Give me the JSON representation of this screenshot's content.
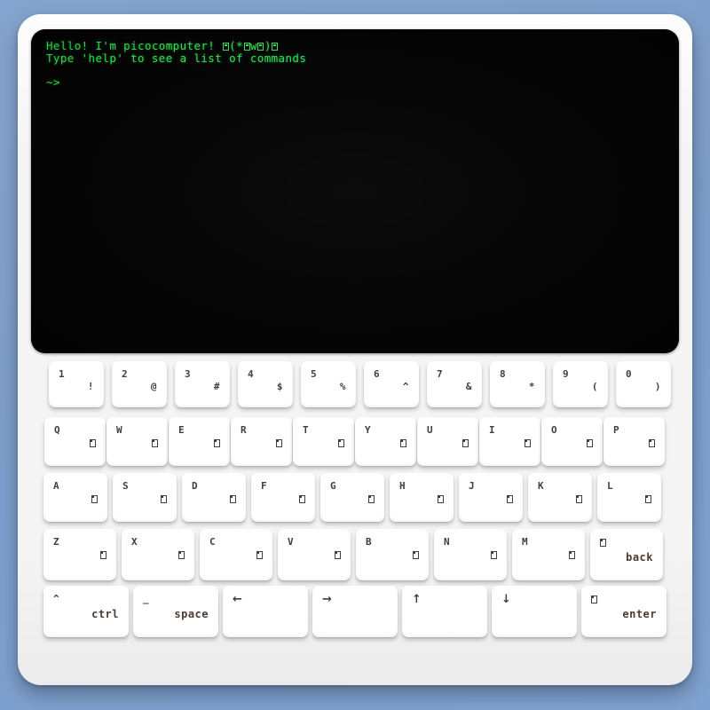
{
  "app": {
    "name": "picocomputer",
    "background_color": "#7fa1cd",
    "body_color": "#f4f4f4",
    "screen_color": "#000000",
    "screen_text_color": "#2de04f",
    "key_color": "#ffffff",
    "key_label_color": "#4a3c33"
  },
  "screen": {
    "lines": [
      "Hello! I'm picocomputer! □(*□w□)□",
      "Type 'help' to see a list of commands",
      "",
      "~>"
    ],
    "line1_prefix": "Hello! I'm picocomputer! ",
    "line2": "Type 'help' to see a list of commands",
    "prompt": "~>",
    "cursor": ""
  },
  "keyboard": {
    "rows": [
      {
        "name": "number-row",
        "keys": [
          {
            "name": "key-1",
            "main": "1",
            "secondary": "!",
            "sec_type": "text"
          },
          {
            "name": "key-2",
            "main": "2",
            "secondary": "@",
            "sec_type": "text"
          },
          {
            "name": "key-3",
            "main": "3",
            "secondary": "#",
            "sec_type": "text"
          },
          {
            "name": "key-4",
            "main": "4",
            "secondary": "$",
            "sec_type": "text"
          },
          {
            "name": "key-5",
            "main": "5",
            "secondary": "%",
            "sec_type": "text"
          },
          {
            "name": "key-6",
            "main": "6",
            "secondary": "^",
            "sec_type": "text"
          },
          {
            "name": "key-7",
            "main": "7",
            "secondary": "&",
            "sec_type": "text"
          },
          {
            "name": "key-8",
            "main": "8",
            "secondary": "*",
            "sec_type": "text"
          },
          {
            "name": "key-9",
            "main": "9",
            "secondary": "(",
            "sec_type": "text"
          },
          {
            "name": "key-0",
            "main": "0",
            "secondary": ")",
            "sec_type": "text"
          }
        ]
      },
      {
        "name": "qwerty-row",
        "keys": [
          {
            "name": "key-q",
            "main": "Q",
            "secondary": "□",
            "sec_type": "tofu"
          },
          {
            "name": "key-w",
            "main": "W",
            "secondary": "□",
            "sec_type": "tofu"
          },
          {
            "name": "key-e",
            "main": "E",
            "secondary": "□",
            "sec_type": "tofu"
          },
          {
            "name": "key-r",
            "main": "R",
            "secondary": "□",
            "sec_type": "tofu"
          },
          {
            "name": "key-t",
            "main": "T",
            "secondary": "□",
            "sec_type": "tofu"
          },
          {
            "name": "key-y",
            "main": "Y",
            "secondary": "□",
            "sec_type": "tofu"
          },
          {
            "name": "key-u",
            "main": "U",
            "secondary": "□",
            "sec_type": "tofu"
          },
          {
            "name": "key-i",
            "main": "I",
            "secondary": "□",
            "sec_type": "tofu"
          },
          {
            "name": "key-o",
            "main": "O",
            "secondary": "□",
            "sec_type": "tofu"
          },
          {
            "name": "key-p",
            "main": "P",
            "secondary": "□",
            "sec_type": "tofu"
          }
        ]
      },
      {
        "name": "home-row",
        "keys": [
          {
            "name": "key-a",
            "main": "A",
            "secondary": "□",
            "sec_type": "tofu"
          },
          {
            "name": "key-s",
            "main": "S",
            "secondary": "□",
            "sec_type": "tofu"
          },
          {
            "name": "key-d",
            "main": "D",
            "secondary": "□",
            "sec_type": "tofu"
          },
          {
            "name": "key-f",
            "main": "F",
            "secondary": "□",
            "sec_type": "tofu"
          },
          {
            "name": "key-g",
            "main": "G",
            "secondary": "□",
            "sec_type": "tofu"
          },
          {
            "name": "key-h",
            "main": "H",
            "secondary": "□",
            "sec_type": "tofu"
          },
          {
            "name": "key-j",
            "main": "J",
            "secondary": "□",
            "sec_type": "tofu"
          },
          {
            "name": "key-k",
            "main": "K",
            "secondary": "□",
            "sec_type": "tofu"
          },
          {
            "name": "key-l",
            "main": "L",
            "secondary": "□",
            "sec_type": "tofu"
          }
        ]
      },
      {
        "name": "zxcv-row",
        "keys": [
          {
            "name": "key-z",
            "main": "Z",
            "secondary": "□",
            "sec_type": "tofu"
          },
          {
            "name": "key-x",
            "main": "X",
            "secondary": "□",
            "sec_type": "tofu"
          },
          {
            "name": "key-c",
            "main": "C",
            "secondary": "□",
            "sec_type": "tofu"
          },
          {
            "name": "key-v",
            "main": "V",
            "secondary": "□",
            "sec_type": "tofu"
          },
          {
            "name": "key-b",
            "main": "B",
            "secondary": "□",
            "sec_type": "tofu"
          },
          {
            "name": "key-n",
            "main": "N",
            "secondary": "□",
            "sec_type": "tofu"
          },
          {
            "name": "key-m",
            "main": "M",
            "secondary": "□",
            "sec_type": "tofu"
          },
          {
            "name": "key-back",
            "main": "□",
            "main_type": "tofu",
            "secondary": "back",
            "sec_type": "word"
          }
        ]
      },
      {
        "name": "bottom-row",
        "keys": [
          {
            "name": "key-ctrl",
            "main": "^",
            "secondary": "ctrl",
            "sec_type": "word"
          },
          {
            "name": "key-space",
            "main": "_",
            "secondary": "space",
            "sec_type": "word"
          },
          {
            "name": "key-arrow-left",
            "main": "←",
            "main_type": "arrow",
            "secondary": "",
            "sec_type": "none"
          },
          {
            "name": "key-arrow-right",
            "main": "→",
            "main_type": "arrow",
            "secondary": "",
            "sec_type": "none"
          },
          {
            "name": "key-arrow-up",
            "main": "↑",
            "main_type": "arrow",
            "secondary": "",
            "sec_type": "none"
          },
          {
            "name": "key-arrow-down",
            "main": "↓",
            "main_type": "arrow",
            "secondary": "",
            "sec_type": "none"
          },
          {
            "name": "key-enter",
            "main": "□",
            "main_type": "tofu",
            "secondary": "enter",
            "sec_type": "word"
          }
        ]
      }
    ]
  }
}
